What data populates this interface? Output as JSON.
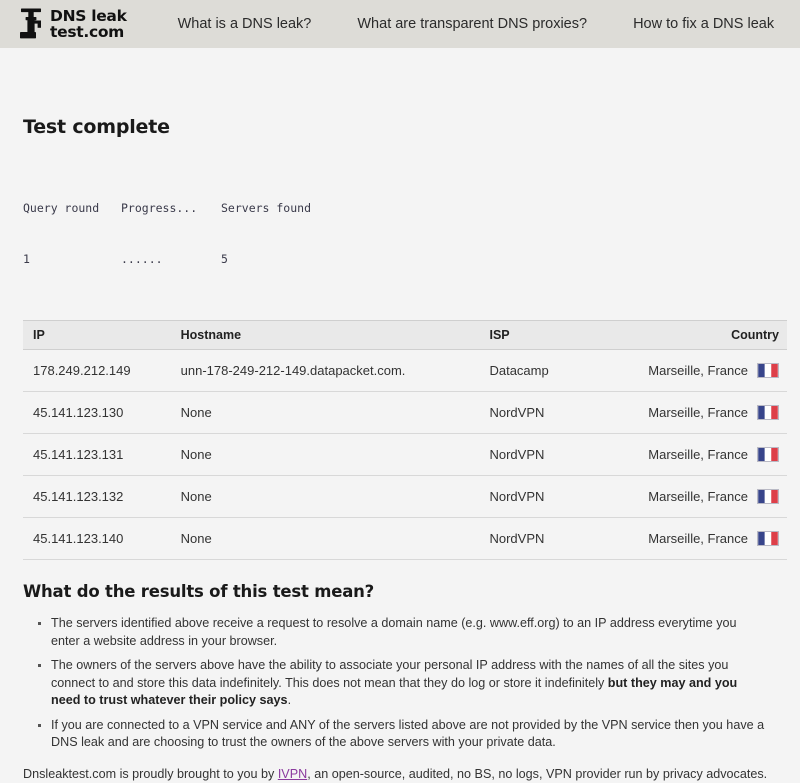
{
  "header": {
    "logo": {
      "icon": "faucet-tap-icon",
      "line1": "DNS leak",
      "line2": "test.com"
    },
    "nav": [
      {
        "label": "What is a DNS leak?"
      },
      {
        "label": "What are transparent DNS proxies?"
      },
      {
        "label": "How to fix a DNS leak"
      }
    ]
  },
  "main": {
    "title": "Test complete",
    "status": {
      "query_round_label": "Query round",
      "query_round_value": "1",
      "progress_label": "Progress...",
      "progress_value": "......",
      "servers_found_label": "Servers found",
      "servers_found_value": "5"
    },
    "table": {
      "columns": [
        "IP",
        "Hostname",
        "ISP",
        "Country"
      ],
      "rows": [
        {
          "ip": "178.249.212.149",
          "hostname": "unn-178-249-212-149.datapacket.com.",
          "isp": "Datacamp",
          "country": "Marseille, France",
          "flag": "flag-france-icon"
        },
        {
          "ip": "45.141.123.130",
          "hostname": "None",
          "isp": "NordVPN",
          "country": "Marseille, France",
          "flag": "flag-france-icon"
        },
        {
          "ip": "45.141.123.131",
          "hostname": "None",
          "isp": "NordVPN",
          "country": "Marseille, France",
          "flag": "flag-france-icon"
        },
        {
          "ip": "45.141.123.132",
          "hostname": "None",
          "isp": "NordVPN",
          "country": "Marseille, France",
          "flag": "flag-france-icon"
        },
        {
          "ip": "45.141.123.140",
          "hostname": "None",
          "isp": "NordVPN",
          "country": "Marseille, France",
          "flag": "flag-france-icon"
        }
      ]
    },
    "explainer": {
      "title": "What do the results of this test mean?",
      "bullets": [
        {
          "text_before": "The servers identified above receive a request to resolve a domain name (e.g. www.eff.org) to an IP address everytime you enter a website address in your browser.",
          "bold": "",
          "text_after": ""
        },
        {
          "text_before": "The owners of the servers above have the ability to associate your personal IP address with the names of all the sites you connect to and store this data indefinitely. This does not mean that they do log or store it indefinitely ",
          "bold": "but they may and you need to trust whatever their policy says",
          "text_after": "."
        },
        {
          "text_before": "If you are connected to a VPN service and ANY of the servers listed above are not provided by the VPN service then you have a DNS leak and are choosing to trust the owners of the above servers with your private data.",
          "bold": "",
          "text_after": ""
        }
      ]
    },
    "footer": {
      "text_before": "Dnsleaktest.com is proudly brought to you by ",
      "link_label": "IVPN",
      "text_after": ", an open-source, audited, no BS, no logs, VPN provider run by privacy advocates."
    }
  },
  "colors": {
    "header_bg": "#dddcd7",
    "page_bg": "#f4f4f4",
    "table_header_bg": "#e9e9e9",
    "link": "#8b3a9e",
    "flag_blue": "#1b2a7a",
    "flag_white": "#ffffff",
    "flag_red": "#d8232f"
  }
}
